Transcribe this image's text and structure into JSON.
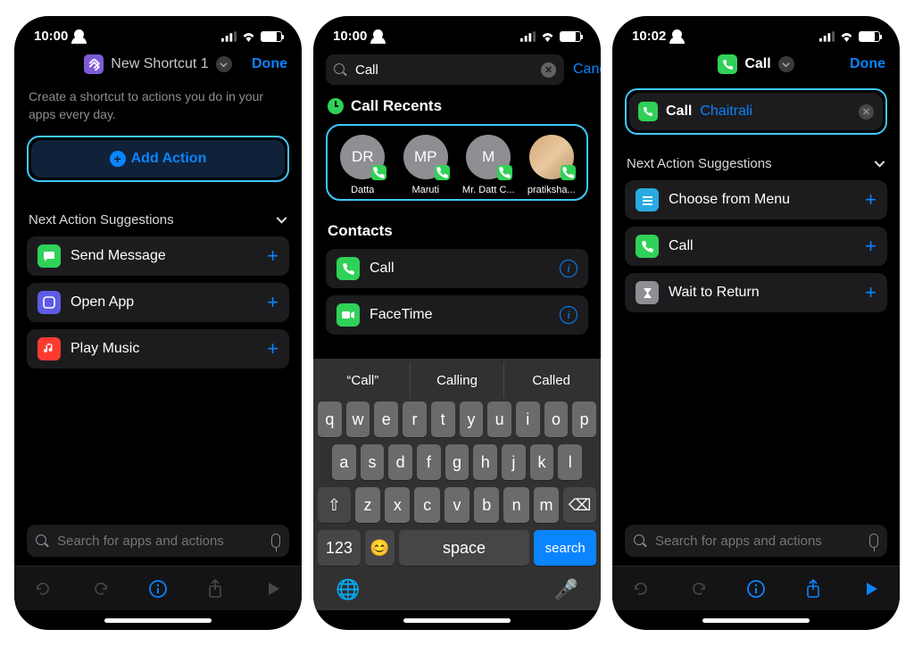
{
  "p1": {
    "time": "10:00",
    "title": "New Shortcut 1",
    "done": "Done",
    "hint": "Create a shortcut to actions you do in your apps every day.",
    "add": "Add Action",
    "sugg_header": "Next Action Suggestions",
    "sugg": [
      {
        "label": "Send Message",
        "color": "#30d158"
      },
      {
        "label": "Open App",
        "color": "#5e5ce6"
      },
      {
        "label": "Play Music",
        "color": "#ff3b30"
      }
    ],
    "search_ph": "Search for apps and actions"
  },
  "p2": {
    "time": "10:00",
    "query": "Call",
    "cancel": "Cancel",
    "recents_title": "Call Recents",
    "recents": [
      {
        "initials": "DR",
        "name": "Datta"
      },
      {
        "initials": "MP",
        "name": "Maruti"
      },
      {
        "initials": "M",
        "name": "Mr. Datt C..."
      },
      {
        "initials": "",
        "name": "pratiksha...",
        "photo": true
      }
    ],
    "contacts_title": "Contacts",
    "contacts": [
      {
        "label": "Call",
        "icon": "phone",
        "color": "#30d158"
      },
      {
        "label": "FaceTime",
        "icon": "video",
        "color": "#30d158"
      }
    ],
    "kb_sugg": [
      "“Call”",
      "Calling",
      "Called"
    ],
    "row1": [
      "q",
      "w",
      "e",
      "r",
      "t",
      "y",
      "u",
      "i",
      "o",
      "p"
    ],
    "row2": [
      "a",
      "s",
      "d",
      "f",
      "g",
      "h",
      "j",
      "k",
      "l"
    ],
    "row3": [
      "z",
      "x",
      "c",
      "v",
      "b",
      "n",
      "m"
    ],
    "space": "space",
    "search_key": "search",
    "numkey": "123"
  },
  "p3": {
    "time": "10:02",
    "title": "Call",
    "done": "Done",
    "action": "Call",
    "param": "Chaitrali",
    "sugg_header": "Next Action Suggestions",
    "sugg": [
      {
        "label": "Choose from Menu",
        "color": "#29aae2"
      },
      {
        "label": "Call",
        "color": "#30d158"
      },
      {
        "label": "Wait to Return",
        "color": "#8e8e93"
      }
    ],
    "search_ph": "Search for apps and actions"
  }
}
